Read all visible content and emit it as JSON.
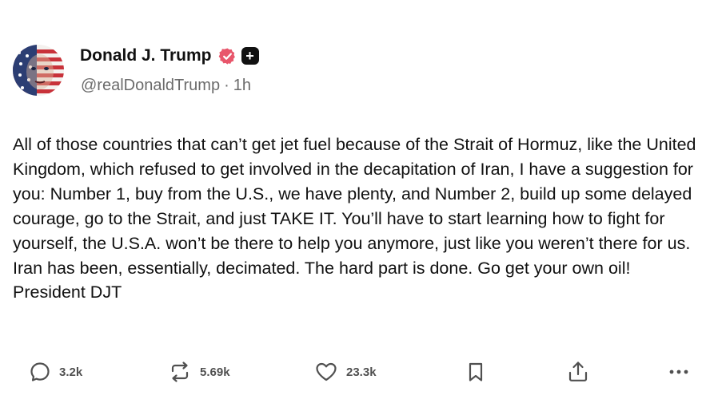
{
  "author": {
    "display_name": "Donald J. Trump",
    "handle": "@realDonaldTrump",
    "separator": "·",
    "time": "1h",
    "verified_color": "#e8566b",
    "avatar_icon": "american-flag-face-avatar"
  },
  "post": {
    "text": "All of those countries that can’t get jet fuel because of the Strait of Hormuz, like the United Kingdom, which refused to get involved in the decapitation of Iran, I have a suggestion for you: Number 1, buy from the U.S., we have plenty, and Number 2, build up some delayed courage, go to the Strait, and just TAKE IT. You’ll have to start learning how to fight for yourself, the U.S.A. won’t be there to help you anymore, just like you weren’t there for us. Iran has been, essentially, decimated. The hard part is done. Go get your own oil! President DJT"
  },
  "actions": {
    "replies": "3.2k",
    "reposts": "5.69k",
    "likes": "23.3k",
    "reply_icon": "comment-icon",
    "repost_icon": "repost-icon",
    "like_icon": "heart-icon",
    "bookmark_icon": "bookmark-icon",
    "share_icon": "share-icon",
    "more_icon": "more-icon"
  }
}
